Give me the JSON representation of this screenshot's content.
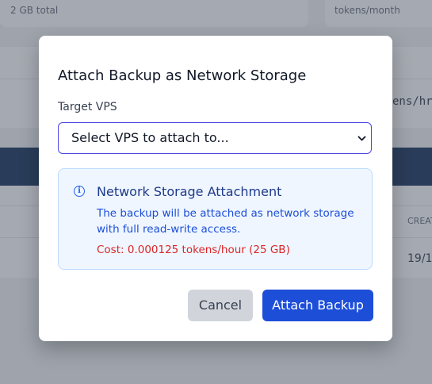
{
  "background": {
    "storage_total": "2 GB total",
    "tokens_unit": "tokens/month",
    "path_fragment": "ens/hr",
    "column_header": "CREAT",
    "row_date": "19/1"
  },
  "modal": {
    "title": "Attach Backup as Network Storage",
    "target_label": "Target VPS",
    "select_placeholder": "Select VPS to attach to...",
    "info": {
      "icon": "info-icon",
      "title": "Network Storage Attachment",
      "body": "The backup will be attached as network storage with full read-write access.",
      "cost": "Cost: 0.000125 tokens/hour (25 GB)"
    },
    "cancel_label": "Cancel",
    "attach_label": "Attach Backup"
  },
  "colors": {
    "primary": "#1d4ed8",
    "info_bg": "#eff6ff",
    "cost": "#dc2626"
  }
}
